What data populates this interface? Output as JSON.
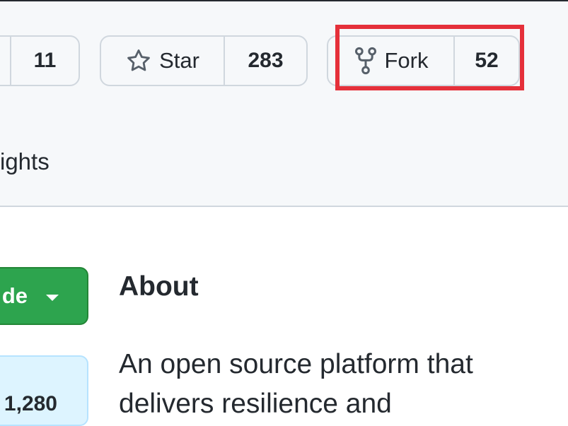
{
  "repo_actions": {
    "watch": {
      "count": "11"
    },
    "star": {
      "label": "Star",
      "count": "283",
      "icon": "star-icon"
    },
    "fork": {
      "label": "Fork",
      "count": "52",
      "icon": "repo-forked-icon"
    }
  },
  "repo_nav": {
    "insights_label": "ights"
  },
  "code_button": {
    "label": "de",
    "icon": "chevron-down-icon"
  },
  "commits": {
    "count": "1,280"
  },
  "about": {
    "heading": "About",
    "description": "An open source platform that delivers resilience and"
  },
  "colors": {
    "header_bg": "#f6f8fa",
    "border": "#d0d7de",
    "code_button_bg": "#2da44e",
    "highlight": "#e5303a",
    "commits_bg": "#ddf4ff"
  }
}
